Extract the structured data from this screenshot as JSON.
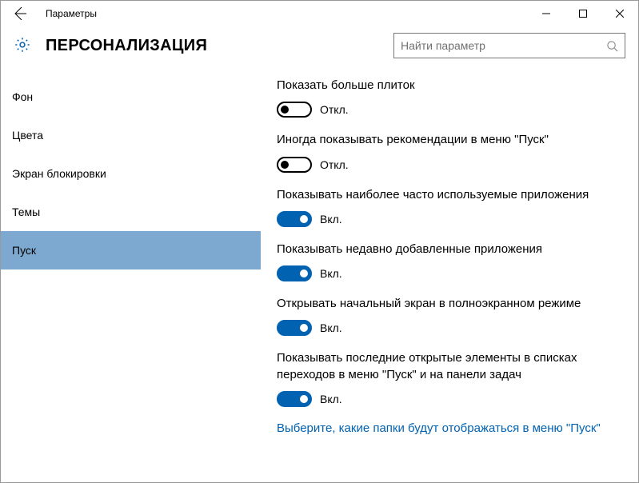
{
  "window": {
    "title": "Параметры"
  },
  "header": {
    "page_title": "ПЕРСОНАЛИЗАЦИЯ",
    "search_placeholder": "Найти параметр"
  },
  "sidebar": {
    "items": [
      {
        "label": "Фон"
      },
      {
        "label": "Цвета"
      },
      {
        "label": "Экран блокировки"
      },
      {
        "label": "Темы"
      },
      {
        "label": "Пуск"
      }
    ],
    "active_index": 4
  },
  "settings": [
    {
      "label": "Показать больше плиток",
      "on": false,
      "state_label": "Откл."
    },
    {
      "label": "Иногда показывать рекомендации в меню \"Пуск\"",
      "on": false,
      "state_label": "Откл."
    },
    {
      "label": "Показывать наиболее часто используемые приложения",
      "on": true,
      "state_label": "Вкл."
    },
    {
      "label": "Показывать недавно добавленные приложения",
      "on": true,
      "state_label": "Вкл."
    },
    {
      "label": "Открывать начальный экран в полноэкранном режиме",
      "on": true,
      "state_label": "Вкл."
    },
    {
      "label": "Показывать последние открытые элементы в списках переходов в меню \"Пуск\" и на панели задач",
      "on": true,
      "state_label": "Вкл."
    }
  ],
  "link": {
    "label": "Выберите, какие папки будут отображаться в меню \"Пуск\""
  }
}
